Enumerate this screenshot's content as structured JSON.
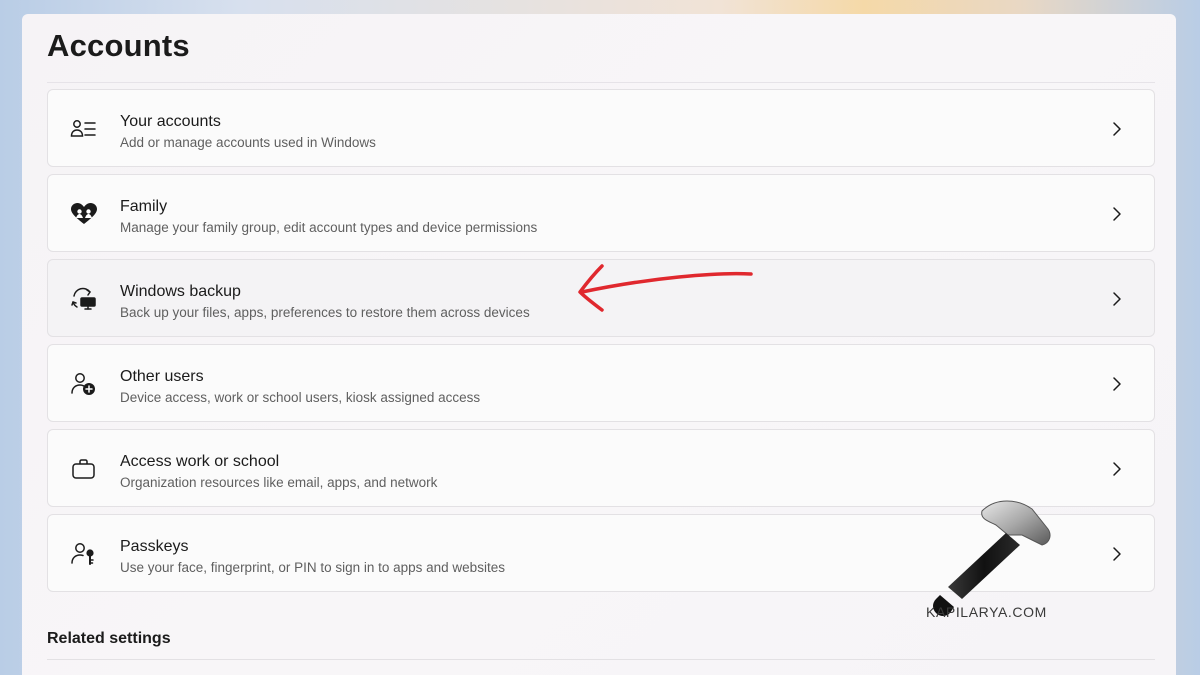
{
  "page": {
    "title": "Accounts"
  },
  "items": [
    {
      "label": "Your accounts",
      "description": "Add or manage accounts used in Windows",
      "icon": "accounts-list-icon"
    },
    {
      "label": "Family",
      "description": "Manage your family group, edit account types and device permissions",
      "icon": "heart-family-icon"
    },
    {
      "label": "Windows backup",
      "description": "Back up your files, apps, preferences to restore them across devices",
      "icon": "sync-backup-icon"
    },
    {
      "label": "Other users",
      "description": "Device access, work or school users, kiosk assigned access",
      "icon": "person-add-icon"
    },
    {
      "label": "Access work or school",
      "description": "Organization resources like email, apps, and network",
      "icon": "briefcase-icon"
    },
    {
      "label": "Passkeys",
      "description": "Use your face, fingerprint, or PIN to sign in to apps and websites",
      "icon": "person-key-icon"
    }
  ],
  "related": {
    "heading": "Related settings"
  },
  "watermark": {
    "text": "KAPILARYA.COM"
  },
  "colors": {
    "annotation_arrow": "#e0282e",
    "text_primary": "#1b1b1b",
    "text_secondary": "#5f5f5f"
  }
}
